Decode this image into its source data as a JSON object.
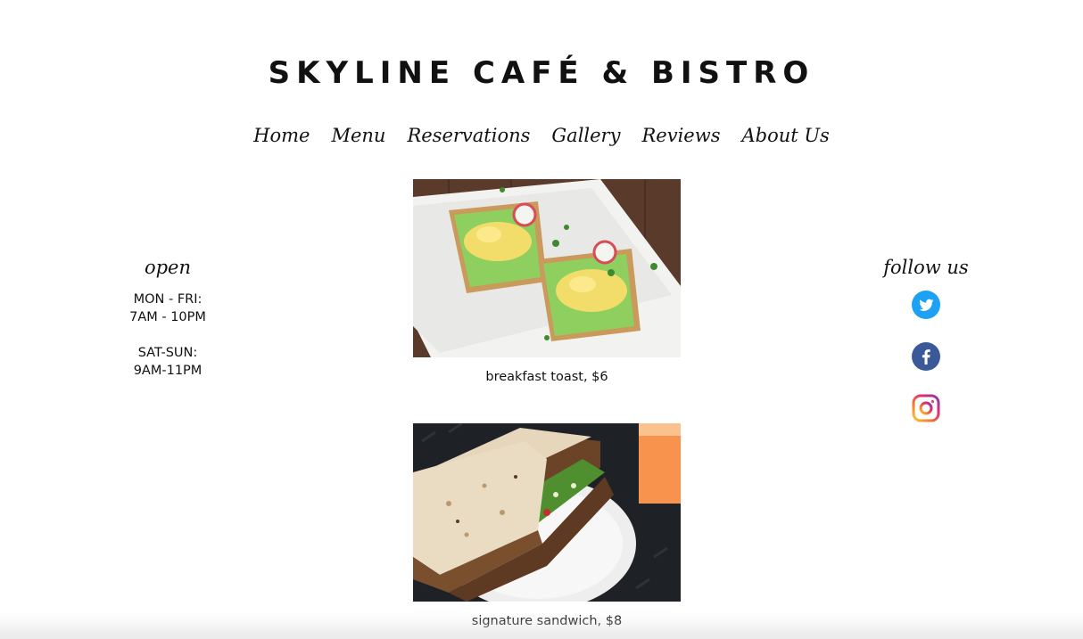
{
  "header": {
    "title": "SKYLINE CAFÉ & BISTRO"
  },
  "nav": {
    "items": [
      {
        "label": "Home"
      },
      {
        "label": "Menu"
      },
      {
        "label": "Reservations"
      },
      {
        "label": "Gallery"
      },
      {
        "label": "Reviews"
      },
      {
        "label": "About Us"
      }
    ]
  },
  "hours": {
    "heading": "open",
    "weekday_days": "MON - FRI:",
    "weekday_time": "7AM - 10PM",
    "weekend_days": "SAT-SUN:",
    "weekend_time": "9AM-11PM"
  },
  "social": {
    "heading": "follow us",
    "icons": [
      {
        "name": "twitter-icon",
        "color": "#1DA1F2"
      },
      {
        "name": "facebook-icon",
        "color": "#3B5998"
      },
      {
        "name": "instagram-icon",
        "color": "#E1306C"
      }
    ]
  },
  "dishes": [
    {
      "caption": "breakfast toast, $6",
      "photo": "avocado-toast-photo"
    },
    {
      "caption": "signature sandwich, $8",
      "photo": "sandwich-photo"
    }
  ]
}
